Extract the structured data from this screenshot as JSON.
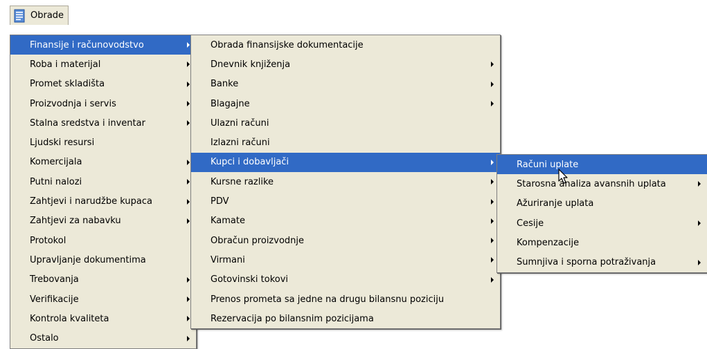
{
  "menubar": {
    "title": "Obrade",
    "icon": "document-list-icon"
  },
  "menu_level_1": {
    "items": [
      {
        "label": "Finansije i računovodstvo",
        "submenu": true,
        "active": true
      },
      {
        "label": "Roba i materijal",
        "submenu": true
      },
      {
        "label": "Promet skladišta",
        "submenu": true
      },
      {
        "label": "Proizvodnja i servis",
        "submenu": true
      },
      {
        "label": "Stalna sredstva i inventar",
        "submenu": true
      },
      {
        "label": "Ljudski resursi",
        "submenu": false
      },
      {
        "label": "Komercijala",
        "submenu": true
      },
      {
        "label": "Putni nalozi",
        "submenu": true
      },
      {
        "label": "Zahtjevi i narudžbe kupaca",
        "submenu": true
      },
      {
        "label": "Zahtjevi za nabavku",
        "submenu": true
      },
      {
        "label": "Protokol",
        "submenu": false
      },
      {
        "label": "Upravljanje dokumentima",
        "submenu": false
      },
      {
        "label": "Trebovanja",
        "submenu": true
      },
      {
        "label": "Verifikacije",
        "submenu": true
      },
      {
        "label": "Kontrola kvaliteta",
        "submenu": true
      },
      {
        "label": "Ostalo",
        "submenu": true
      }
    ]
  },
  "menu_level_2": {
    "items": [
      {
        "label": "Obrada finansijske dokumentacije",
        "submenu": false
      },
      {
        "label": "Dnevnik knjiženja",
        "submenu": true
      },
      {
        "label": "Banke",
        "submenu": true
      },
      {
        "label": "Blagajne",
        "submenu": true
      },
      {
        "label": "Ulazni računi",
        "submenu": false
      },
      {
        "label": "Izlazni računi",
        "submenu": false
      },
      {
        "label": "Kupci i dobavljači",
        "submenu": true,
        "active": true
      },
      {
        "label": "Kursne razlike",
        "submenu": true
      },
      {
        "label": "PDV",
        "submenu": true
      },
      {
        "label": "Kamate",
        "submenu": true
      },
      {
        "label": "Obračun proizvodnje",
        "submenu": true
      },
      {
        "label": "Virmani",
        "submenu": true
      },
      {
        "label": "Gotovinski tokovi",
        "submenu": true
      },
      {
        "label": "Prenos prometa sa jedne na drugu bilansnu poziciju",
        "submenu": false
      },
      {
        "label": "Rezervacija po bilansnim pozicijama",
        "submenu": false
      }
    ]
  },
  "menu_level_3": {
    "items": [
      {
        "label": "Računi uplate",
        "submenu": false,
        "active": true
      },
      {
        "label": "Starosna analiza avansnih uplata",
        "submenu": true
      },
      {
        "label": "Ažuriranje uplata",
        "submenu": false
      },
      {
        "label": "Cesije",
        "submenu": true
      },
      {
        "label": "Kompenzacije",
        "submenu": false
      },
      {
        "label": "Sumnjiva i sporna potraživanja",
        "submenu": true
      }
    ]
  },
  "colors": {
    "menu_bg": "#ece9d8",
    "highlight": "#316ac5",
    "highlight_text": "#ffffff"
  }
}
